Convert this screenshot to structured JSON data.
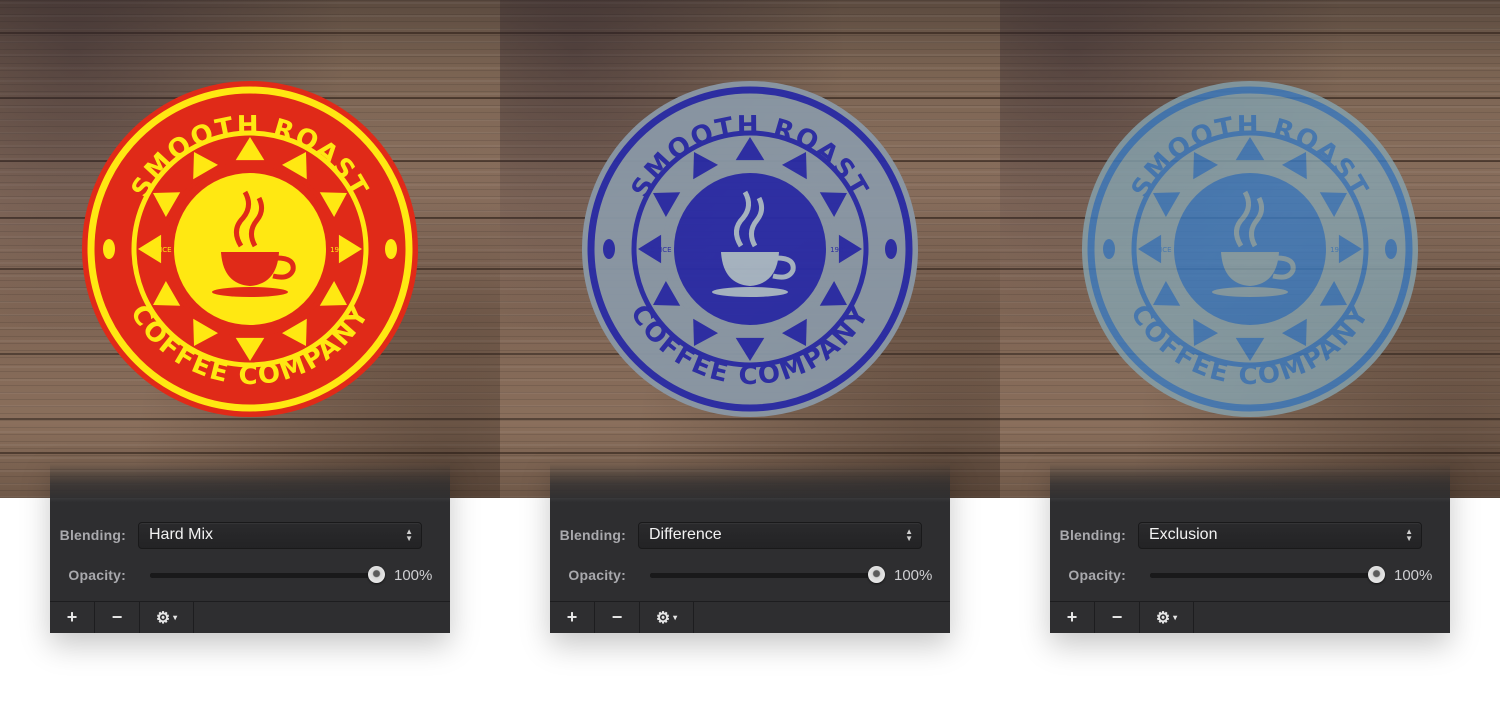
{
  "panels": [
    {
      "badge": {
        "top_text": "SMOOTH ROAST",
        "bottom_text": "COFFEE COMPANY",
        "since_label": "SINCE",
        "year": "1981"
      },
      "colors": {
        "outer": "#e02a18",
        "ring": "#ffe812",
        "inner": "#ffe812",
        "ink": "#e02a18",
        "opacity_visual": 1.0
      },
      "blending_label": "Blending:",
      "blending_value": "Hard Mix",
      "opacity_label": "Opacity:",
      "opacity_value": "100%",
      "opacity_level": 1.0
    },
    {
      "badge": {
        "top_text": "SMOOTH ROAST",
        "bottom_text": "COFFEE COMPANY",
        "since_label": "SINCE",
        "year": "1981"
      },
      "colors": {
        "outer": "#8a98a6",
        "ring": "#2a2ca6",
        "inner": "#2a2ca6",
        "ink": "#a7b6c4",
        "opacity_visual": 0.95
      },
      "blending_label": "Blending:",
      "blending_value": "Difference",
      "opacity_label": "Opacity:",
      "opacity_value": "100%",
      "opacity_level": 1.0
    },
    {
      "badge": {
        "top_text": "SMOOTH ROAST",
        "bottom_text": "COFFEE COMPANY",
        "since_label": "SINCE",
        "year": "1981"
      },
      "colors": {
        "outer": "#86a4b0",
        "ring": "#3b7cc3",
        "inner": "#3b7cc3",
        "ink": "#86a4b0",
        "opacity_visual": 0.8
      },
      "blending_label": "Blending:",
      "blending_value": "Exclusion",
      "opacity_label": "Opacity:",
      "opacity_value": "100%",
      "opacity_level": 1.0
    }
  ],
  "toolbar": {
    "add_glyph": "+",
    "remove_glyph": "−",
    "gear_glyph": "⚙",
    "caret_glyph": "▾"
  },
  "icons": {
    "add": "plus-icon",
    "remove": "minus-icon",
    "gear": "gear-icon",
    "select": "updown-arrows-icon",
    "cup": "coffee-cup-icon",
    "bean": "coffee-bean-icon"
  }
}
